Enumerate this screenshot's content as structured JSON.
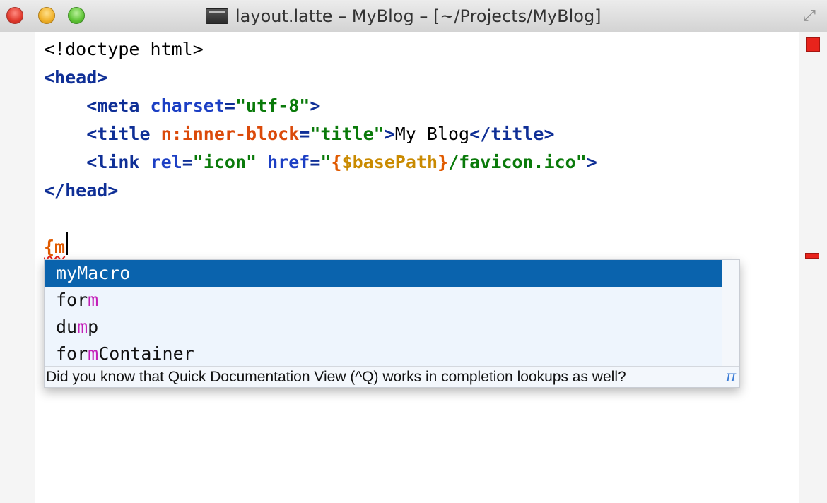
{
  "window": {
    "title": "layout.latte – MyBlog – [~/Projects/MyBlog]",
    "file_icon": "document-icon",
    "fullscreen_icon": "fullscreen-arrows-icon"
  },
  "editor": {
    "lines": {
      "l1": {
        "text": "<!doctype html>"
      },
      "l2": {
        "text": "<head>"
      },
      "l3": {
        "open": "<meta",
        "attr": "charset",
        "eq": "=",
        "val": "\"utf-8\"",
        "close": ">"
      },
      "l4": {
        "open": "<title",
        "attr": "n:inner-block",
        "eq": "=",
        "val": "\"title\"",
        "close": ">",
        "content": "My Blog",
        "end": "</title>"
      },
      "l5": {
        "open": "<link",
        "attr1": "rel",
        "eq1": "=",
        "val1": "\"icon\"",
        "attr2": "href",
        "eq2": "=",
        "q": "\"",
        "var_open": "{",
        "var": "$basePath",
        "var_close": "}",
        "val_rest": "/favicon.ico\"",
        "close": ">"
      },
      "l6": {
        "text": "</head>"
      },
      "l8": {
        "text": "{m"
      }
    },
    "colors": {
      "tag": "#0f2f96",
      "attribute": "#1c3fc4",
      "latte_attribute": "#db4a0a",
      "string": "#0a7a0a",
      "macro": "#e05a00",
      "variable": "#c98a00",
      "error": "#e8231c"
    }
  },
  "completion": {
    "items": [
      {
        "pre": "myMacro",
        "match": "",
        "post": "",
        "selected": true
      },
      {
        "pre": "for",
        "match": "m",
        "post": ""
      },
      {
        "pre": "du",
        "match": "m",
        "post": "p"
      },
      {
        "pre": "for",
        "match": "m",
        "post": "Container"
      }
    ],
    "hint": "Did you know that Quick Documentation View (^Q) works in completion lookups as well?",
    "pi_label": "π",
    "selection_color": "#0a63ad",
    "match_color": "#c41fb8"
  }
}
